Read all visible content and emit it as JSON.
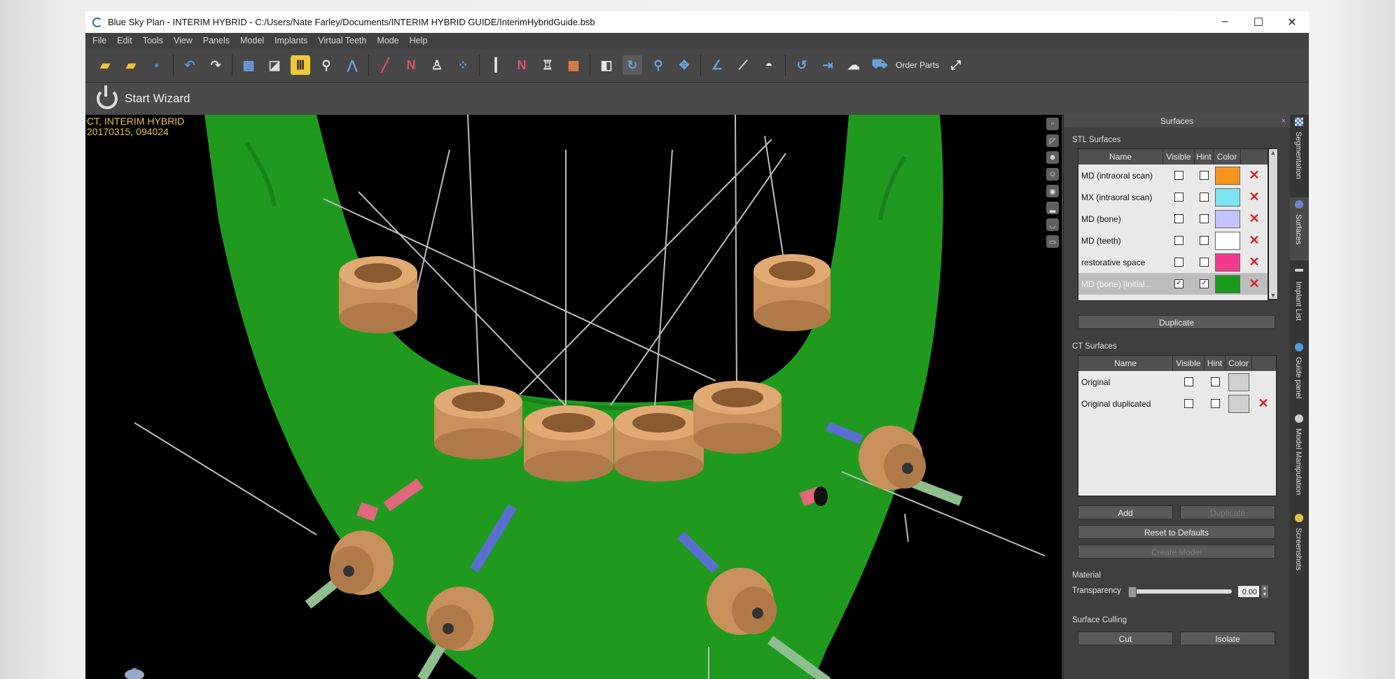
{
  "window": {
    "title": "Blue Sky Plan - INTERIM HYBRID - C:/Users/Nate Farley/Documents/INTERIM HYBRID GUIDE/InterimHybridGuide.bsb",
    "controls": [
      "–",
      "☐",
      "✕"
    ]
  },
  "menu": [
    "File",
    "Edit",
    "Tools",
    "View",
    "Panels",
    "Model",
    "Implants",
    "Virtual Teeth",
    "Mode",
    "Help"
  ],
  "toolbar": {
    "order_parts_label": "Order Parts",
    "icons": [
      "open-folder-icon",
      "open-folder-dropdown-icon",
      "save-icon",
      "undo-icon",
      "redo-icon",
      "grid-icon",
      "scan-icon",
      "ruler-icon",
      "zoom-magnifier-icon",
      "curve-icon",
      "pen-icon",
      "nerve-icon",
      "tooth-icon",
      "points-icon",
      "implant-icon",
      "spline-icon",
      "crown-icon",
      "teeth-set-icon",
      "contrast-icon",
      "rotate-icon",
      "zoom-icon",
      "pan-icon",
      "angle-icon",
      "measure-icon",
      "protractor-icon",
      "reset-view-icon",
      "export-icon",
      "share-icon",
      "cart-icon",
      "fullscreen-icon"
    ]
  },
  "wizard": {
    "label": "Start Wizard"
  },
  "viewport": {
    "ct_line1": "CT, INTERIM HYBRID",
    "ct_line2": "20170315, 094024",
    "colors": {
      "bone": "#1f9a1f",
      "sleeve": "#c8905a",
      "axis_blue": "#5a6ed0",
      "axis_green": "#8fbf8f",
      "axis_red": "#e0687a"
    }
  },
  "panel": {
    "title": "Surfaces",
    "close": "×",
    "stl_label": "STL Surfaces",
    "stl_headers": [
      "Name",
      "Visible",
      "Hint",
      "Color"
    ],
    "stl_rows": [
      {
        "name": "MD (intraoral scan)",
        "visible": false,
        "hint": false,
        "color": "#f7941d",
        "selected": false
      },
      {
        "name": "MX (intraoral scan)",
        "visible": false,
        "hint": false,
        "color": "#7fe4f2",
        "selected": false
      },
      {
        "name": "MD (bone)",
        "visible": false,
        "hint": false,
        "color": "#c5c3ff",
        "selected": false
      },
      {
        "name": "MD (teeth)",
        "visible": false,
        "hint": false,
        "color": "#ffffff",
        "selected": false
      },
      {
        "name": "restorative space",
        "visible": false,
        "hint": false,
        "color": "#f23a8c",
        "selected": false
      },
      {
        "name": "MD (bone) [initial...",
        "visible": true,
        "hint": true,
        "color": "#1a9a1a",
        "selected": true
      }
    ],
    "duplicate_label": "Duplicate",
    "ct_label": "CT Surfaces",
    "ct_headers": [
      "Name",
      "Visible",
      "Hint",
      "Color"
    ],
    "ct_rows": [
      {
        "name": "Original",
        "visible": false,
        "hint": false,
        "color": "#d0d0d0",
        "deletable": false
      },
      {
        "name": "Original duplicated",
        "visible": false,
        "hint": false,
        "color": "#d0d0d0",
        "deletable": true
      }
    ],
    "add_label": "Add",
    "ct_duplicate_label": "Duplicate",
    "reset_label": "Reset to Defaults",
    "create_model_label": "Create Model",
    "material_label": "Material",
    "transparency_label": "Transparency",
    "transparency_value": "0.00",
    "transparency_fraction": 0,
    "culling_label": "Surface Culling",
    "cut_label": "Cut",
    "isolate_label": "Isolate"
  },
  "side_tabs": [
    "Segmentation",
    "Surfaces",
    "Implant List",
    "Guide panel",
    "Model Manipulation",
    "Screenshots"
  ],
  "mark": {
    "check": "✓",
    "delete": "✕"
  }
}
